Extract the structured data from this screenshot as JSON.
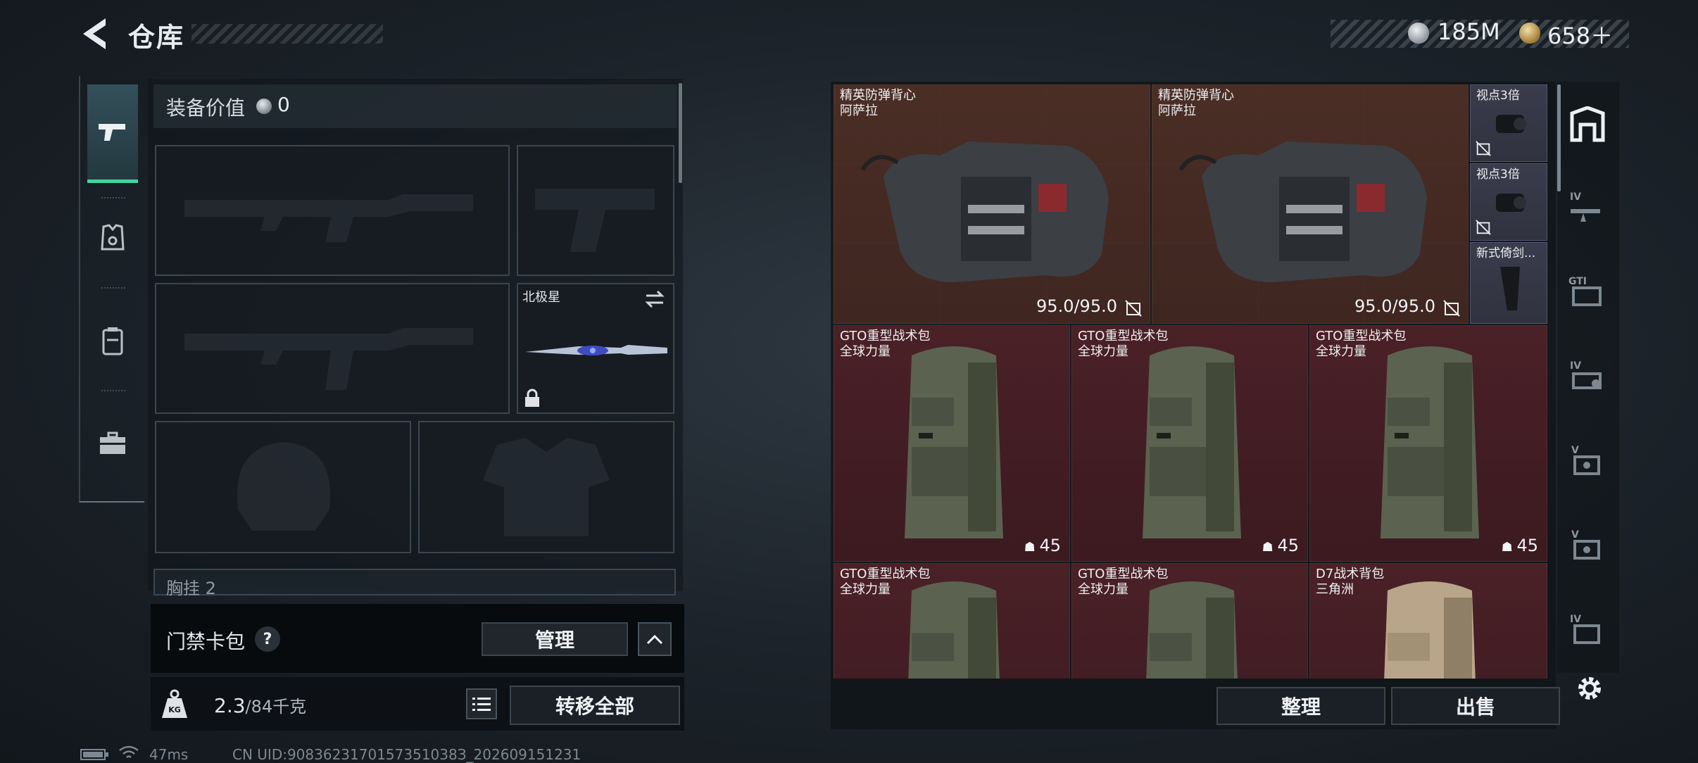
{
  "header": {
    "title": "仓库",
    "currency_silver": "185M",
    "currency_gold": "658＋"
  },
  "equipment": {
    "value_label": "装备价值",
    "value": "0",
    "knife_label": "北极星",
    "sub_header_label": "胸挂",
    "sub_header_count": "2"
  },
  "card_pack": {
    "label": "门禁卡包",
    "help": "?",
    "manage_button": "管理"
  },
  "weight": {
    "current": "2.3",
    "max": "/84千克"
  },
  "buttons": {
    "transfer_all": "转移全部",
    "sort": "整理",
    "sell": "出售"
  },
  "status": {
    "ping": "47ms",
    "uid": "CN UID:9083623170157351038З_202609151231"
  },
  "storage": {
    "vests": [
      {
        "name": "精英防弹背心",
        "maker": "阿萨拉",
        "durability": "95.0/95.0"
      },
      {
        "name": "精英防弹背心",
        "maker": "阿萨拉",
        "durability": "95.0/95.0"
      }
    ],
    "small_items": [
      {
        "name": "视点3倍"
      },
      {
        "name": "视点3倍"
      },
      {
        "name": "新式倚剑..."
      }
    ],
    "backpacks_row1": [
      {
        "name": "GTO重型战术包",
        "maker": "全球力量",
        "qty": "45"
      },
      {
        "name": "GTO重型战术包",
        "maker": "全球力量",
        "qty": "45"
      },
      {
        "name": "GTO重型战术包",
        "maker": "全球力量",
        "qty": "45"
      }
    ],
    "backpacks_row2": [
      {
        "name": "GTO重型战术包",
        "maker": "全球力量"
      },
      {
        "name": "GTO重型战术包",
        "maker": "全球力量"
      },
      {
        "name": "D7战术背包",
        "maker": "三角洲"
      }
    ]
  },
  "right_tabs": [
    "IV",
    "GTI",
    "IV",
    "V",
    "V",
    "IV"
  ],
  "colors": {
    "accent_green": "#41d4a0",
    "vest_bg": "#4a2e26",
    "bag_bg": "#4a2127",
    "attachment_bg": "#3a3c4c"
  }
}
